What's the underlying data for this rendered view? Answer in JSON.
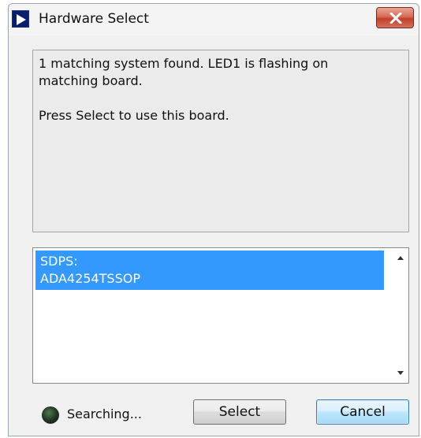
{
  "window": {
    "title": "Hardware Select",
    "app_icon": "play-icon",
    "close_icon": "close-icon"
  },
  "message": {
    "line1": "1 matching system found. LED1 is flashing on matching board.",
    "line2": "Press Select to use this board."
  },
  "list": {
    "items": [
      {
        "line1": "SDPS:",
        "line2": "ADA4254TSSOP",
        "selected": true
      }
    ],
    "scroll_up_icon": "chevron-up-icon",
    "scroll_down_icon": "chevron-down-icon"
  },
  "footer": {
    "led_color": "#22361f",
    "status": "Searching...",
    "select_label": "Select",
    "cancel_label": "Cancel"
  },
  "colors": {
    "selection": "#3399ff",
    "close_button": "#c2402c",
    "window_bg": "#f0f0f0"
  }
}
